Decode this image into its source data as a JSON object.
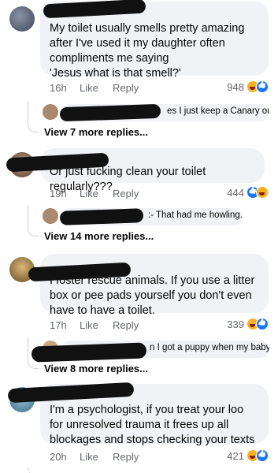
{
  "comments": [
    {
      "text": "My toilet usually smells pretty amazing after I've used it my daughter often compliments me saying\n'Jesus what is that smell?'",
      "time": "16h",
      "like_label": "Like",
      "reply_label": "Reply",
      "reaction_count": "948",
      "reactions": [
        "haha",
        "like"
      ],
      "reply_preview": "es I just keep a Canary on t...",
      "more_replies": "View 7 more replies..."
    },
    {
      "text": "Or just fucking clean your toilet regularly???",
      "time": "19h",
      "like_label": "Like",
      "reply_label": "Reply",
      "reaction_count": "444",
      "reactions": [
        "like",
        "haha"
      ],
      "reply_preview": ":- That had me howling.",
      "more_replies": "View 14 more replies..."
    },
    {
      "text": "I foster rescue animals. If you use a litter box or pee pads yourself you don't even have to have a toilet.",
      "time": "17h",
      "like_label": "Like",
      "reply_label": "Reply",
      "reaction_count": "339",
      "reactions": [
        "haha",
        "like"
      ],
      "reply_preview": "n I got a puppy when my baby ...",
      "more_replies": "View 8 more replies..."
    },
    {
      "text": "I'm a psychologist, if you treat your loo for unresolved trauma it frees up all blockages and stops checking your texts",
      "time": "20h",
      "like_label": "Like",
      "reply_label": "Reply",
      "reaction_count": "421",
      "reactions": [
        "haha",
        "like"
      ]
    }
  ],
  "colors": {
    "bubble": "#f0f2f5",
    "meta_text": "#65676b",
    "redaction": "#111111"
  }
}
